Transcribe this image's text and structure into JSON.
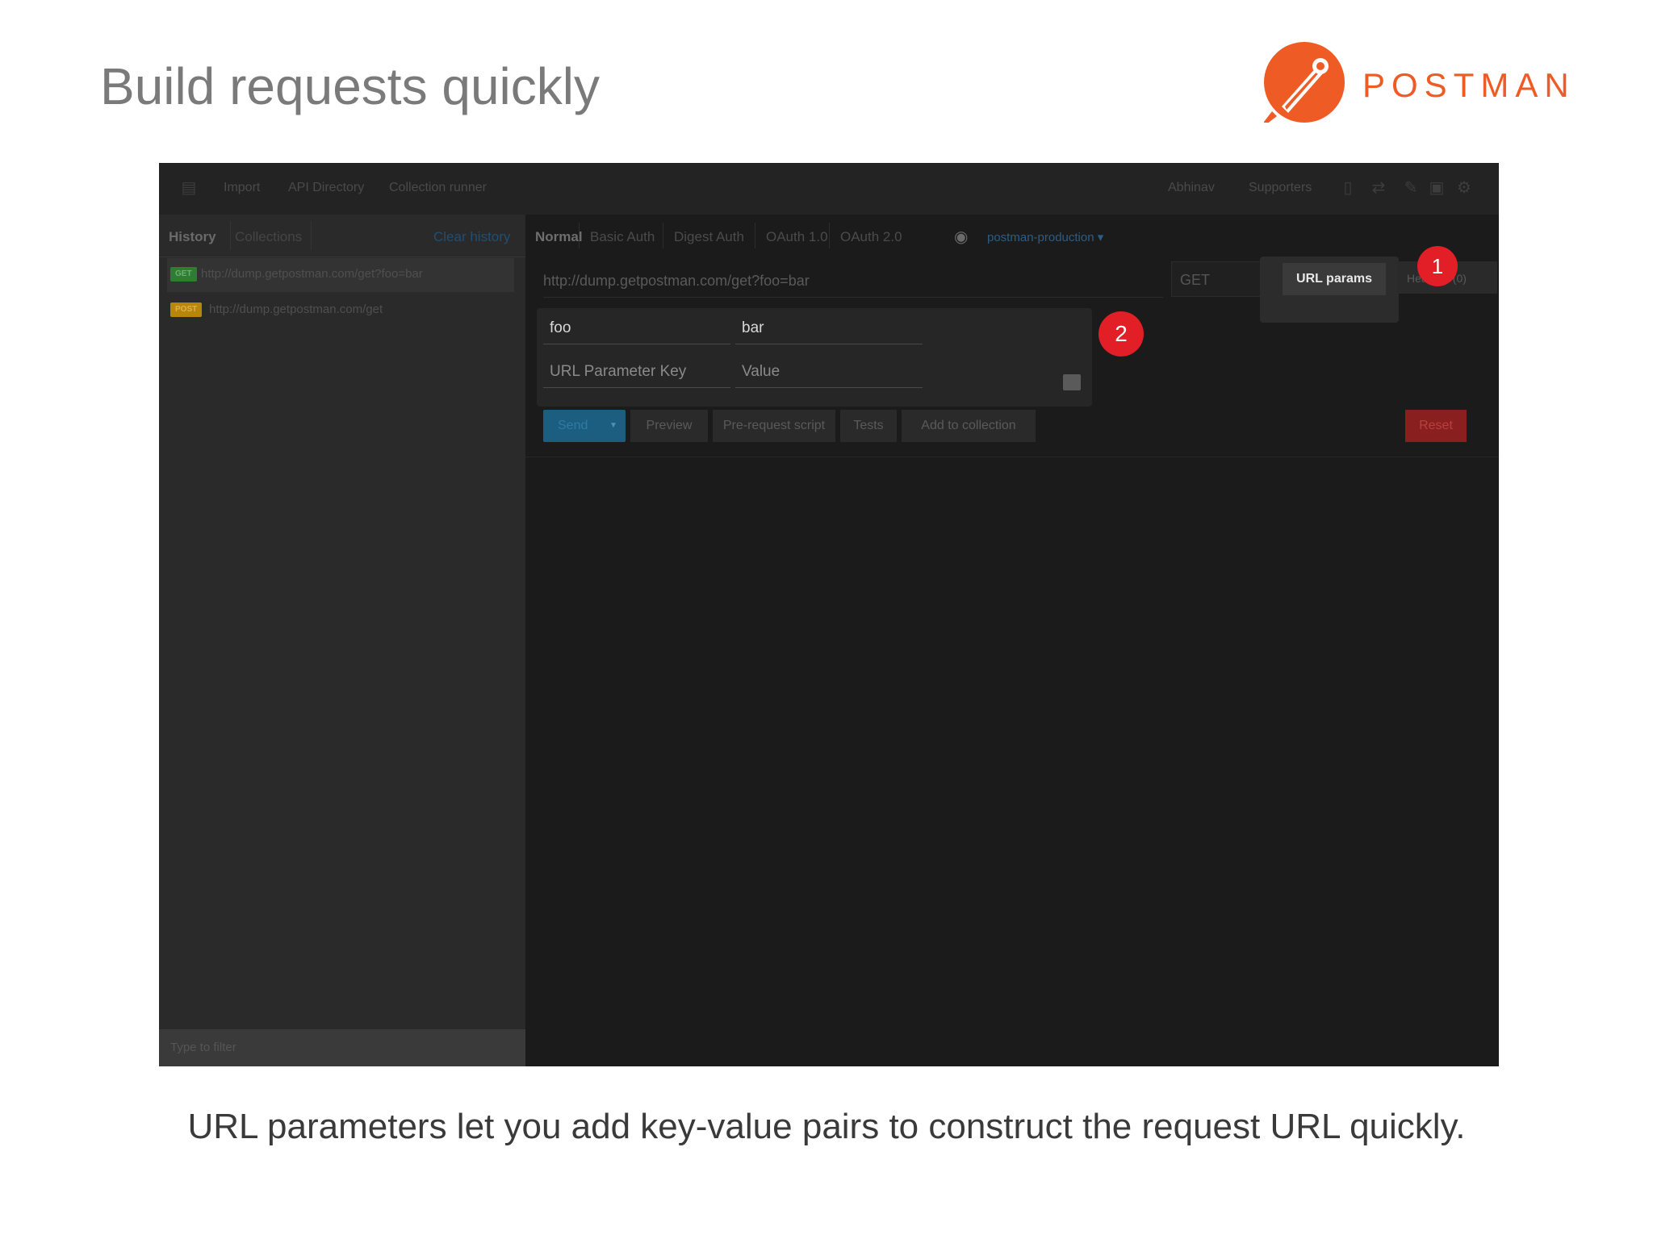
{
  "slide": {
    "title": "Build requests quickly",
    "logo_text": "POSTMAN",
    "caption": "URL parameters let you add key-value pairs to construct the request URL quickly."
  },
  "topbar": {
    "nav": [
      "Import",
      "API Directory",
      "Collection runner"
    ],
    "right": [
      "Abhinav",
      "Supporters"
    ]
  },
  "sidebar": {
    "tabs": {
      "history": "History",
      "collections": "Collections",
      "clear": "Clear history"
    },
    "items": [
      {
        "method": "GET",
        "url": "http://dump.getpostman.com/get?foo=bar",
        "badge_color": "#2e7d32"
      },
      {
        "method": "POST",
        "url": "http://dump.getpostman.com/get",
        "badge_color": "#b8860b"
      }
    ],
    "filter_placeholder": "Type to filter"
  },
  "request": {
    "auth_tabs": [
      "Normal",
      "Basic Auth",
      "Digest Auth",
      "OAuth 1.0",
      "OAuth 2.0"
    ],
    "environment": "postman-production",
    "url": "http://dump.getpostman.com/get?foo=bar",
    "method": "GET",
    "url_params_label": "URL params",
    "headers_label": "Headers (0)",
    "params": [
      {
        "key": "foo",
        "value": "bar"
      }
    ],
    "new_param": {
      "key_placeholder": "URL Parameter Key",
      "value_placeholder": "Value"
    },
    "actions": {
      "send": "Send",
      "preview": "Preview",
      "prerequest": "Pre-request script",
      "tests": "Tests",
      "add": "Add to collection",
      "reset": "Reset"
    }
  },
  "callouts": {
    "one": "1",
    "two": "2"
  }
}
